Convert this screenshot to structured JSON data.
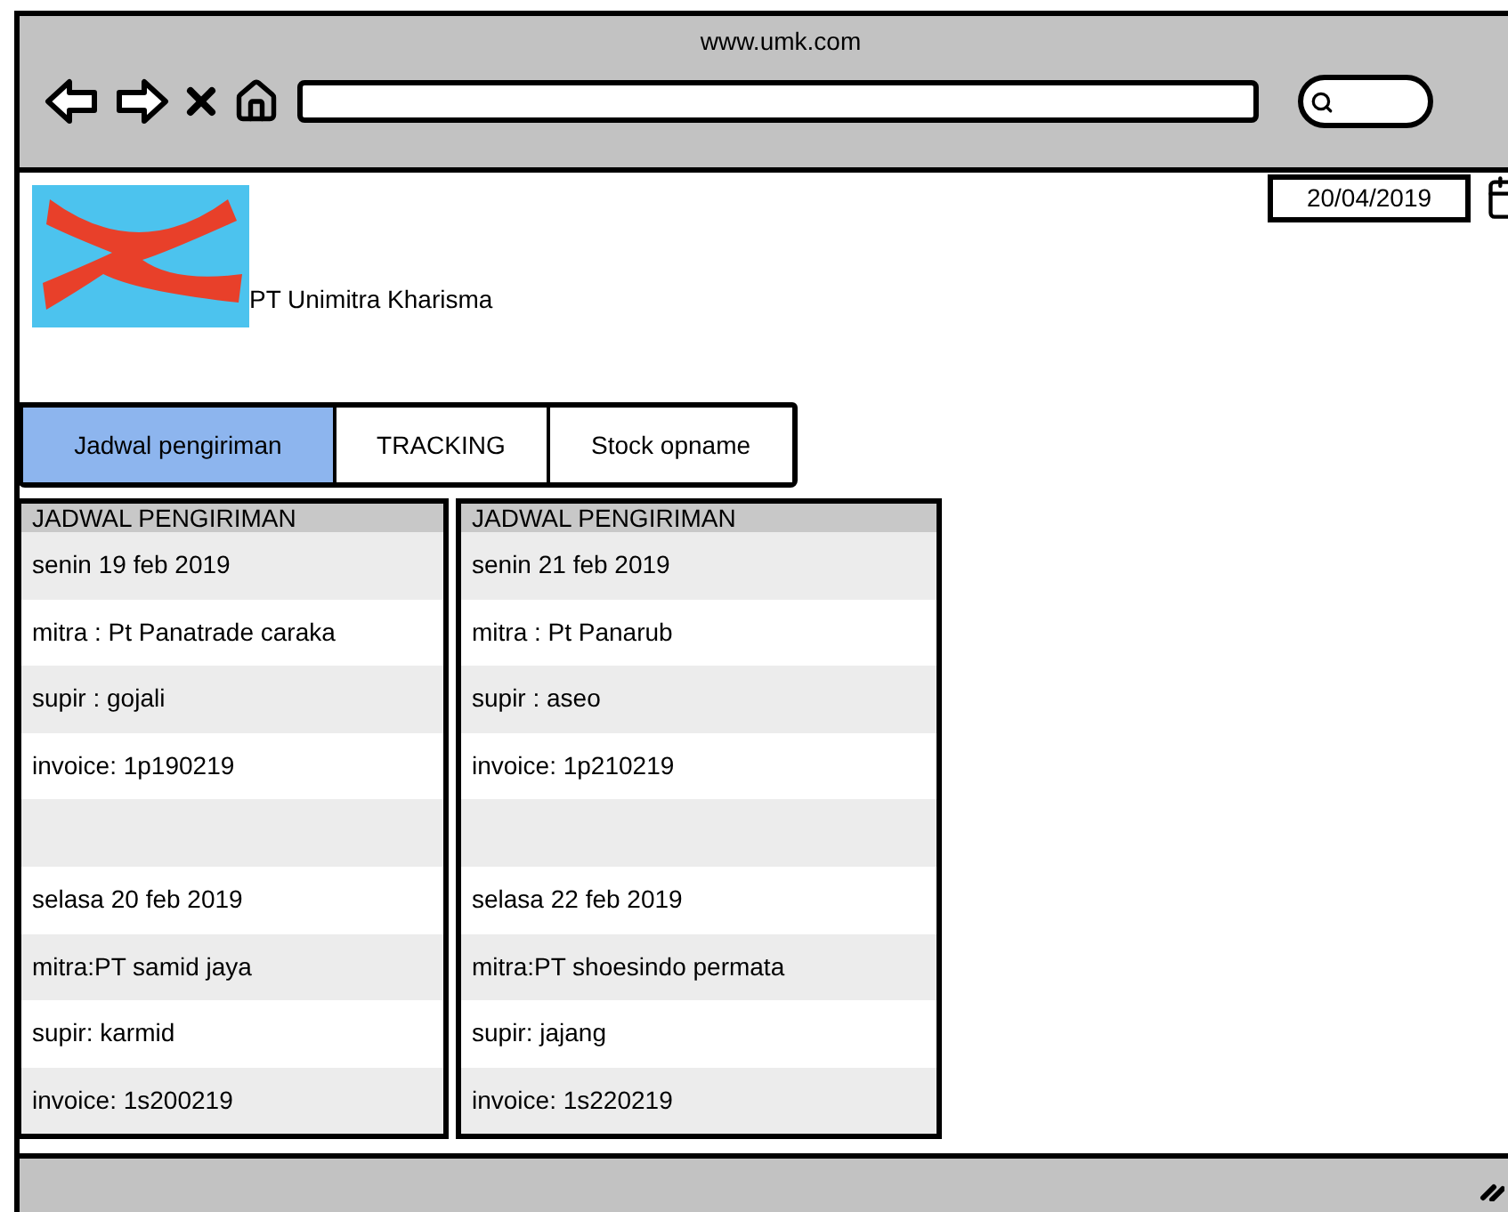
{
  "browser": {
    "url_title": "www.umk.com"
  },
  "company": {
    "name": "PT Unimitra Kharisma"
  },
  "date_field": {
    "value": "20/04/2019"
  },
  "tabs": [
    {
      "label": "Jadwal pengiriman",
      "selected": true
    },
    {
      "label": "TRACKING",
      "selected": false
    },
    {
      "label": "Stock opname",
      "selected": false
    }
  ],
  "panels": [
    {
      "title": "JADWAL PENGIRIMAN",
      "rows": [
        {
          "kind": "text",
          "text": "senin 19 feb 2019"
        },
        {
          "kind": "text",
          "text": "mitra : Pt Panatrade caraka"
        },
        {
          "kind": "text",
          "text": "supir : gojali"
        },
        {
          "kind": "text",
          "text": "invoice: 1p190219"
        },
        {
          "kind": "blank"
        },
        {
          "kind": "text",
          "text": "selasa 20 feb 2019"
        },
        {
          "kind": "text",
          "text": "mitra:PT samid jaya"
        },
        {
          "kind": "text",
          "text": "supir: karmid"
        },
        {
          "kind": "text",
          "text": "invoice: 1s200219"
        }
      ]
    },
    {
      "title": "JADWAL PENGIRIMAN",
      "rows": [
        {
          "kind": "text",
          "text": "senin 21 feb 2019"
        },
        {
          "kind": "text",
          "text": "mitra : Pt Panarub"
        },
        {
          "kind": "text",
          "text": "supir : aseo"
        },
        {
          "kind": "text",
          "text": "invoice: 1p210219"
        },
        {
          "kind": "blank"
        },
        {
          "kind": "text",
          "text": "selasa 22 feb 2019"
        },
        {
          "kind": "text",
          "text": "mitra:PT shoesindo permata"
        },
        {
          "kind": "text",
          "text": "supir: jajang"
        },
        {
          "kind": "text",
          "text": "invoice: 1s220219"
        }
      ]
    }
  ]
}
